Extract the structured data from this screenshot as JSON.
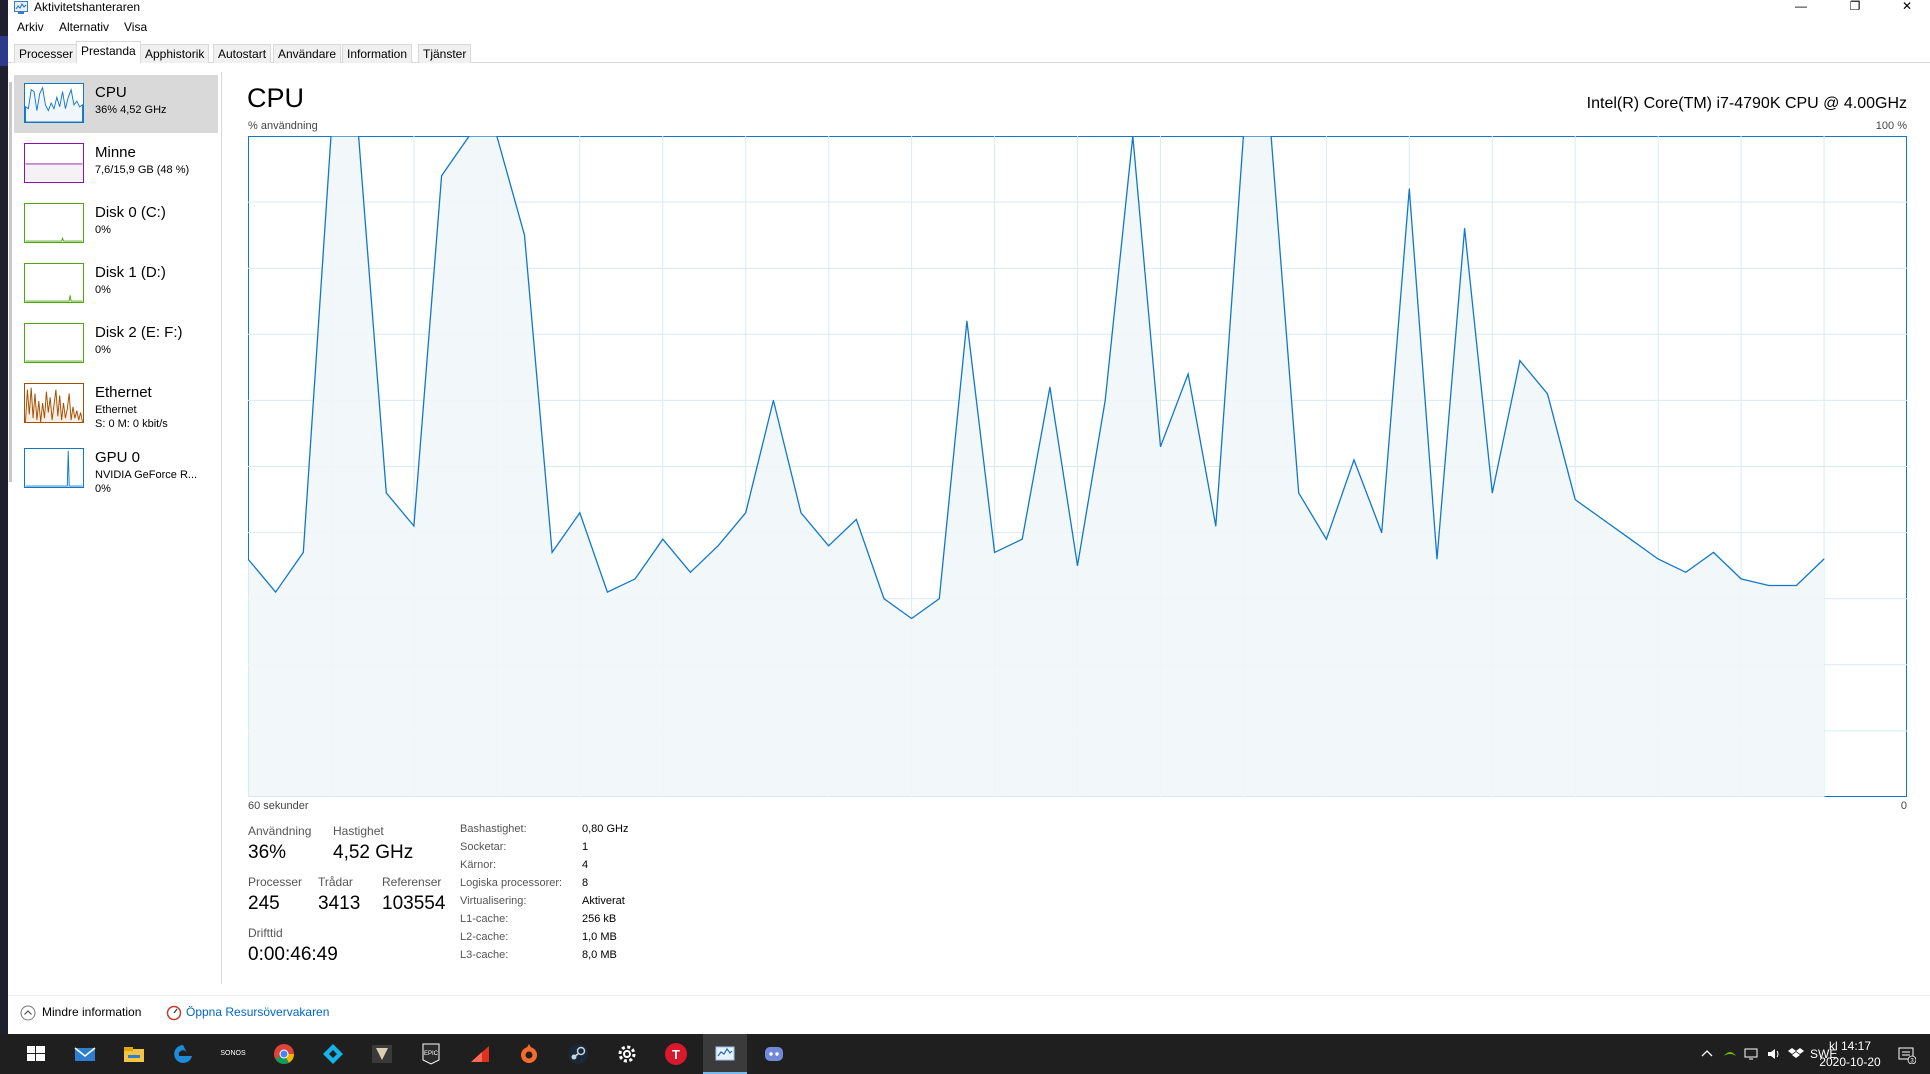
{
  "window": {
    "title": "Aktivitetshanteraren",
    "min_glyph": "—",
    "restore_glyph": "❐",
    "close_glyph": "✕"
  },
  "menu": [
    "Arkiv",
    "Alternativ",
    "Visa"
  ],
  "tabs": [
    "Processer",
    "Prestanda",
    "Apphistorik",
    "Autostart",
    "Användare",
    "Information",
    "Tjänster"
  ],
  "active_tab": "Prestanda",
  "sidebar": [
    {
      "name": "CPU",
      "line1": "36% 4,52 GHz",
      "line2": "",
      "color": "#1178c9"
    },
    {
      "name": "Minne",
      "line1": "7,6/15,9 GB (48 %)",
      "line2": "",
      "color": "#8b12ae"
    },
    {
      "name": "Disk 0 (C:)",
      "line1": "0%",
      "line2": "",
      "color": "#4da60c"
    },
    {
      "name": "Disk 1 (D:)",
      "line1": "0%",
      "line2": "",
      "color": "#4da60c"
    },
    {
      "name": "Disk 2 (E: F:)",
      "line1": "0%",
      "line2": "",
      "color": "#4da60c"
    },
    {
      "name": "Ethernet",
      "line1": "Ethernet",
      "line2": "S: 0 M: 0 kbit/s",
      "color": "#a74f01"
    },
    {
      "name": "GPU 0",
      "line1": "NVIDIA GeForce R...",
      "line2": "0%",
      "color": "#1178c9"
    }
  ],
  "main": {
    "title": "CPU",
    "cpu_model": "Intel(R) Core(TM) i7-4790K CPU @ 4.00GHz",
    "y_label": "% användning",
    "y_max": "100 %",
    "x_left": "60 sekunder",
    "x_right": "0"
  },
  "chart_data": {
    "type": "area",
    "xlabel": "60 sekunder",
    "ylabel": "% användning",
    "ylim": [
      0,
      100
    ],
    "xlim": [
      60,
      0
    ],
    "grid": true,
    "color": "#1178c9",
    "fill": "#f1f6fa",
    "x": [
      60,
      59,
      58,
      57,
      56,
      55,
      54,
      53,
      52,
      51,
      50,
      49,
      48,
      47,
      46,
      45,
      44,
      43,
      42,
      41,
      40,
      39,
      38,
      37,
      36,
      35,
      34,
      33,
      32,
      31,
      30,
      29,
      28,
      27,
      26,
      25,
      24,
      23,
      22,
      21,
      20,
      19,
      18,
      17,
      16,
      15,
      14,
      13,
      12,
      11,
      10,
      9,
      8,
      7,
      6,
      5,
      4,
      3,
      2,
      1,
      0
    ],
    "values": [
      36,
      31,
      37,
      100,
      100,
      46,
      41,
      94,
      100,
      100,
      85,
      37,
      43,
      31,
      33,
      39,
      34,
      38,
      43,
      60,
      43,
      38,
      42,
      30,
      27,
      30,
      72,
      37,
      39,
      62,
      35,
      60,
      100,
      53,
      64,
      41,
      100,
      100,
      46,
      39,
      51,
      40,
      92,
      36,
      86,
      46,
      66,
      61,
      45,
      42,
      39,
      36,
      34,
      37,
      33,
      32,
      32,
      36
    ],
    "usage": "36%",
    "speed": "4,52 GHz"
  },
  "stats": {
    "usage_label": "Användning",
    "usage_value": "36%",
    "speed_label": "Hastighet",
    "speed_value": "4,52 GHz",
    "proc_label": "Processer",
    "proc_value": "245",
    "threads_label": "Trådar",
    "threads_value": "3413",
    "handles_label": "Referenser",
    "handles_value": "103554",
    "uptime_label": "Drifttid",
    "uptime_value": "0:00:46:49"
  },
  "details": [
    {
      "key": "Bashastighet:",
      "value": "0,80 GHz"
    },
    {
      "key": "Socketar:",
      "value": "1"
    },
    {
      "key": "Kärnor:",
      "value": "4"
    },
    {
      "key": "Logiska processorer:",
      "value": "8"
    },
    {
      "key": "Virtualisering:",
      "value": "Aktiverat"
    },
    {
      "key": "L1-cache:",
      "value": "256 kB"
    },
    {
      "key": "L2-cache:",
      "value": "1,0 MB"
    },
    {
      "key": "L3-cache:",
      "value": "8,0 MB"
    }
  ],
  "footer": {
    "less_info": "Mindre information",
    "open_rm": "Öppna Resursövervakaren"
  },
  "taskbar": {
    "icons": [
      "windows-start",
      "mail",
      "file-explorer",
      "edge",
      "sonos",
      "chrome",
      "kodi",
      "gta",
      "epic-games",
      "red-app",
      "origin",
      "steam",
      "settings",
      "t-app",
      "task-manager",
      "discord"
    ],
    "sonos_text": "SONOS",
    "epic_text": "EPIC",
    "t_text": "T",
    "language": "SWE",
    "time": "kl 14:17",
    "date": "2020-10-20",
    "notifications": "3"
  }
}
